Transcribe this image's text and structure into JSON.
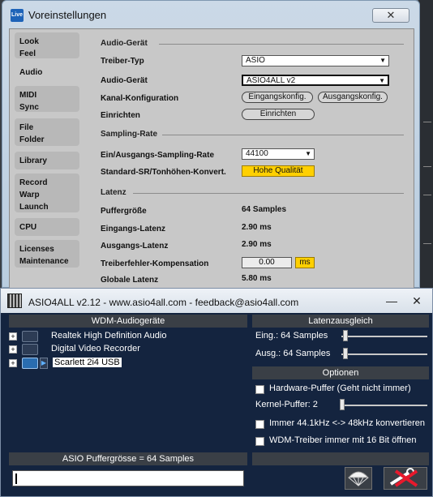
{
  "live": {
    "logo_text": "Live",
    "title": "Voreinstellungen",
    "close_glyph": "✕",
    "nav": [
      {
        "line1": "Look",
        "line2": "Feel"
      },
      {
        "line1": "Audio",
        "line2": ""
      },
      {
        "line1": "MIDI",
        "line2": "Sync"
      },
      {
        "line1": "File",
        "line2": "Folder"
      },
      {
        "line1": "Library",
        "line2": ""
      },
      {
        "line1": "Record",
        "line2": "Warp",
        "line3": "Launch"
      },
      {
        "line1": "CPU",
        "line2": ""
      },
      {
        "line1": "Licenses",
        "line2": "Maintenance"
      }
    ],
    "audio_device_section": "Audio-Gerät",
    "driver_type_label": "Treiber-Typ",
    "driver_type_value": "ASIO",
    "audio_device_label": "Audio-Gerät",
    "audio_device_value": "ASIO4ALL v2",
    "channel_config_label": "Kanal-Konfiguration",
    "input_config_button": "Eingangskonfig.",
    "output_config_button": "Ausgangskonfig.",
    "setup_label": "Einrichten",
    "setup_button": "Einrichten",
    "sampling_section": "Sampling-Rate",
    "sample_rate_label": "Ein/Ausgangs-Sampling-Rate",
    "sample_rate_value": "44100",
    "sr_conversion_label": "Standard-SR/Tonhöhen-Konvert.",
    "sr_conversion_value": "Hohe Qualität",
    "latency_section": "Latenz",
    "buffer_size_label": "Puffergröße",
    "buffer_size_value": "64 Samples",
    "input_latency_label": "Eingangs-Latenz",
    "input_latency_value": "2.90 ms",
    "output_latency_label": "Ausgangs-Latenz",
    "output_latency_value": "2.90 ms",
    "driver_error_label": "Treiberfehler-Kompensation",
    "driver_error_value": "0.00",
    "driver_error_unit": "ms",
    "overall_latency_label": "Globale Latenz",
    "overall_latency_value": "5.80 ms",
    "dropdown_arrow": "▼"
  },
  "asio": {
    "title": "ASIO4ALL v2.12 - www.asio4all.com - feedback@asio4all.com",
    "minimize_glyph": "—",
    "close_glyph": "✕",
    "devices_header": "WDM-Audiogeräte",
    "devices": [
      {
        "name": "Realtek High Definition Audio",
        "active": false
      },
      {
        "name": "Digital Video Recorder",
        "active": false
      },
      {
        "name": "Scarlett 2i4 USB",
        "active": true
      }
    ],
    "expand_glyph": "+",
    "play_glyph": "▶",
    "latency_header": "Latenzausgleich",
    "in_latency_label": "Eing.:  64 Samples",
    "out_latency_label": "Ausg.: 64 Samples",
    "options_header": "Optionen",
    "hw_buffer_label": "Hardware-Puffer (Geht nicht immer)",
    "kernel_buffer_label": "Kernel-Puffer: 2",
    "convert_label": "Immer 44.1kHz <-> 48kHz konvertieren",
    "wdm16_label": "WDM-Treiber immer mit 16 Bit öffnen",
    "buffer_size_header": "ASIO Puffergrösse = 64 Samples",
    "buffer_value": ""
  }
}
